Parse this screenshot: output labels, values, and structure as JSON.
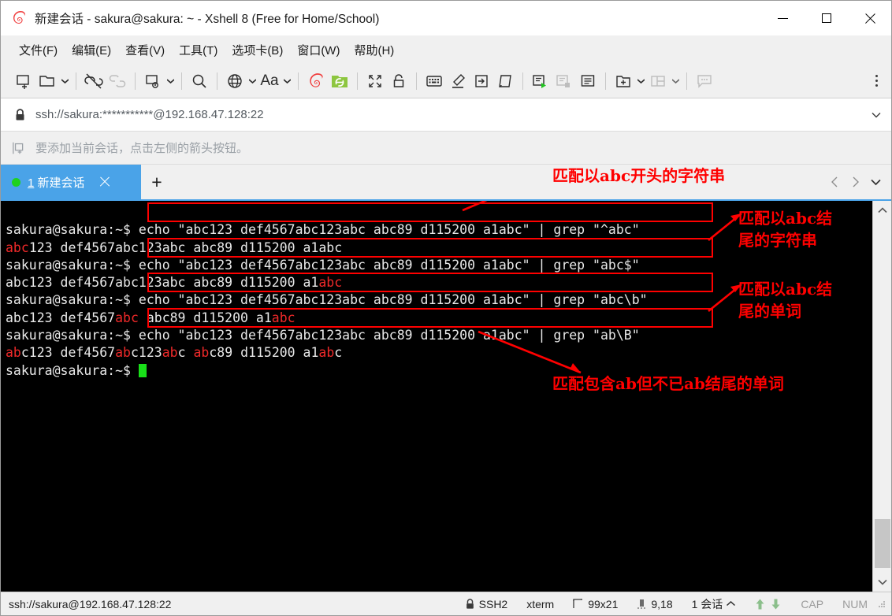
{
  "window": {
    "title": "新建会话 - sakura@sakura: ~ - Xshell 8 (Free for Home/School)",
    "logo_icon": "xshell-logo-icon",
    "minimize_label": "最小化",
    "maximize_label": "最大化",
    "close_label": "关闭"
  },
  "menubar": {
    "items": [
      {
        "label": "文件(F)",
        "name": "menu-file"
      },
      {
        "label": "编辑(E)",
        "name": "menu-edit"
      },
      {
        "label": "查看(V)",
        "name": "menu-view"
      },
      {
        "label": "工具(T)",
        "name": "menu-tools"
      },
      {
        "label": "选项卡(B)",
        "name": "menu-tab"
      },
      {
        "label": "窗口(W)",
        "name": "menu-window"
      },
      {
        "label": "帮助(H)",
        "name": "menu-help"
      }
    ]
  },
  "toolbar": {
    "items": [
      {
        "icon": "new-session-icon",
        "label": "新建会话"
      },
      {
        "icon": "open-folder-icon",
        "label": "打开"
      },
      {
        "icon": "disconnect-icon",
        "label": "断开"
      },
      {
        "icon": "reconnect-link-icon",
        "label": "重新连接"
      },
      {
        "icon": "session-properties-icon",
        "label": "属性"
      },
      {
        "icon": "search-icon",
        "label": "查找"
      },
      {
        "icon": "globe-encoding-icon",
        "label": "编码"
      },
      {
        "icon": "font-size-icon",
        "label": "字体"
      },
      {
        "icon": "xshell-logo-icon",
        "label": "Xshell"
      },
      {
        "icon": "xftp-icon",
        "label": "新建文件传输"
      },
      {
        "icon": "fullscreen-icon",
        "label": "全屏"
      },
      {
        "icon": "lock-icon",
        "label": "锁定"
      },
      {
        "icon": "keyboard-icon",
        "label": "键盘"
      },
      {
        "icon": "highlight-pen-icon",
        "label": "高亮"
      },
      {
        "icon": "send-key-icon",
        "label": "发送键"
      },
      {
        "icon": "paste-scroll-icon",
        "label": "粘贴"
      },
      {
        "icon": "run-script-icon",
        "label": "运行脚本"
      },
      {
        "icon": "stop-script-icon",
        "label": "停止脚本"
      },
      {
        "icon": "log-icon",
        "label": "日志"
      },
      {
        "icon": "add-tab-icon",
        "label": "添加"
      },
      {
        "icon": "split-layout-icon",
        "label": "排列"
      },
      {
        "icon": "chat-icon",
        "label": "撰写栏"
      }
    ],
    "overflow_icon": "kebab-menu-icon"
  },
  "address_bar": {
    "lock_icon": "lock-closed-icon",
    "url": "ssh://sakura:***********@192.168.47.128:22",
    "dropdown_icon": "chevron-down-icon"
  },
  "hint_bar": {
    "icon": "add-session-icon",
    "text": "要添加当前会话，点击左侧的箭头按钮。"
  },
  "tabbar": {
    "tabs": [
      {
        "index": "1",
        "title": "新建会话",
        "status_icon": "connected-dot",
        "close_icon": "close-icon"
      }
    ],
    "new_tab_icon": "plus-icon",
    "prev_icon": "chevron-left-icon",
    "next_icon": "chevron-right-icon",
    "list_icon": "chevron-down-icon"
  },
  "terminal": {
    "prompt": "sakura@sakura:~$ ",
    "lines": [
      {
        "type": "command",
        "prompt": "sakura@sakura:~$ ",
        "command": "echo \"abc123 def4567abc123abc abc89 d115200 a1abc\" | grep \"^abc\""
      },
      {
        "type": "output",
        "segments": [
          {
            "text": "abc",
            "color": "red"
          },
          {
            "text": "123 def4567abc123abc abc89 d115200 a1abc",
            "color": "white"
          }
        ]
      },
      {
        "type": "command",
        "prompt": "sakura@sakura:~$ ",
        "command": "echo \"abc123 def4567abc123abc abc89 d115200 a1abc\" | grep \"abc$\""
      },
      {
        "type": "output",
        "segments": [
          {
            "text": "abc123 def4567abc123abc abc89 d115200 a1",
            "color": "white"
          },
          {
            "text": "abc",
            "color": "red"
          }
        ]
      },
      {
        "type": "command",
        "prompt": "sakura@sakura:~$ ",
        "command": "echo \"abc123 def4567abc123abc abc89 d115200 a1abc\" | grep \"abc\\b\""
      },
      {
        "type": "output",
        "segments": [
          {
            "text": "abc123 def4567",
            "color": "white"
          },
          {
            "text": "abc",
            "color": "red"
          },
          {
            "text": " abc89 d115200 a1",
            "color": "white"
          },
          {
            "text": "abc",
            "color": "red"
          }
        ]
      },
      {
        "type": "command",
        "prompt": "sakura@sakura:~$ ",
        "command": "echo \"abc123 def4567abc123abc abc89 d115200 a1abc\" | grep \"ab\\B\""
      },
      {
        "type": "output",
        "segments": [
          {
            "text": "ab",
            "color": "red"
          },
          {
            "text": "c123 def4567",
            "color": "white"
          },
          {
            "text": "ab",
            "color": "red"
          },
          {
            "text": "c123",
            "color": "white"
          },
          {
            "text": "ab",
            "color": "red"
          },
          {
            "text": "c ",
            "color": "white"
          },
          {
            "text": "ab",
            "color": "red"
          },
          {
            "text": "c89 d115200 a1",
            "color": "white"
          },
          {
            "text": "ab",
            "color": "red"
          },
          {
            "text": "c",
            "color": "white"
          }
        ]
      },
      {
        "type": "prompt-only",
        "prompt": "sakura@sakura:~$ ",
        "cursor": true
      }
    ]
  },
  "annotations": [
    {
      "name": "annotation-starts-with-abc",
      "text": "匹配以abc开头的字符串"
    },
    {
      "name": "annotation-ends-with-abc-string",
      "text": "匹配以abc结\n尾的字符串"
    },
    {
      "name": "annotation-ends-with-abc-word",
      "text": "匹配以abc结\n尾的单词"
    },
    {
      "name": "annotation-contains-ab-not-ending",
      "text": "匹配包含ab但不已ab结尾的单词"
    }
  ],
  "scrollbar": {
    "up_icon": "chevron-up-icon",
    "down_icon": "chevron-down-icon"
  },
  "statusbar": {
    "url": "ssh://sakura@192.168.47.128:22",
    "security_icon": "lock-closed-icon",
    "protocol": "SSH2",
    "terminal_type": "xterm",
    "size_icon": "terminal-size-icon",
    "size": "99x21",
    "cursor_icon": "cursor-position-icon",
    "cursor_pos": "9,18",
    "sessions": "1 会话",
    "sessions_caret": "caret-up-icon",
    "upload_icon": "arrow-up-icon",
    "download_icon": "arrow-down-icon",
    "caps": "CAP",
    "num": "NUM"
  },
  "colors": {
    "accent": "#4aa3e8",
    "annotation_red": "#ff0000",
    "terminal_bg": "#000000",
    "terminal_fg": "#e6e6e6",
    "terminal_match": "#ef2929",
    "cursor": "#19e019",
    "connected_dot": "#1fd11f"
  }
}
